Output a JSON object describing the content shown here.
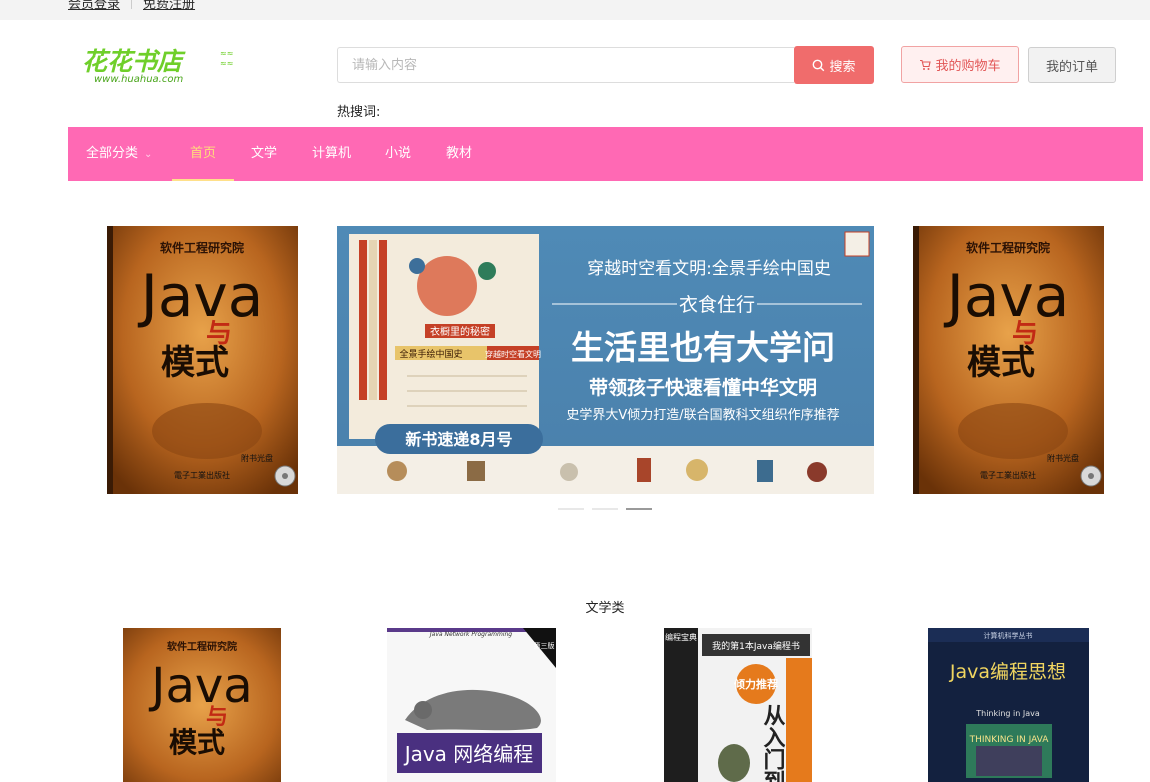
{
  "topbar": {
    "login": "会员登录",
    "register": "免费注册"
  },
  "logo": {
    "text": "花花书店",
    "subtext": "www.huahua.com"
  },
  "search": {
    "placeholder": "请输入内容",
    "button_label": "搜索"
  },
  "header": {
    "cart_label": "我的购物车",
    "orders_label": "我的订单",
    "hot_label": "热搜词:"
  },
  "nav": {
    "all_categories": "全部分类",
    "items": [
      "首页",
      "文学",
      "计算机",
      "小说",
      "教材"
    ],
    "active_index": 0
  },
  "carousel": {
    "side_book": {
      "series": "软件工程研究院",
      "title_1": "Java",
      "title_2": "与",
      "title_3": "模式",
      "publisher": "電子工業出版社"
    },
    "banner": {
      "line1": "穿越时空看文明:全景手绘中国史",
      "line2": "衣食住行",
      "line3": "生活里也有大学问",
      "line4": "带领孩子快速看懂中华文明",
      "line5": "史学界大V倾力打造/联合国教科文组织作序推荐",
      "badge": "新书速递8月号",
      "book_label": "衣橱里的秘密",
      "book_strip": "全景手绘中国史",
      "book_strip2": "穿越时空看文明"
    },
    "slide_count": 3,
    "active_slide": 2
  },
  "section": {
    "title": "文学类",
    "books": [
      {
        "title_1": "Java",
        "title_2": "与",
        "title_3": "模式",
        "series": "软件工程研究院"
      },
      {
        "subtitle": "Java Network Programming",
        "title": "Java 网络编程",
        "edition": "第三版"
      },
      {
        "tag": "编程宝典",
        "header": "我的第1本Java编程书",
        "promo": "倾力推荐",
        "title": "从入门到"
      },
      {
        "series": "计算机科学丛书",
        "title": "Java编程思想",
        "sub": "Thinking in Java",
        "cover_text": "THINKING IN JAVA"
      }
    ]
  }
}
